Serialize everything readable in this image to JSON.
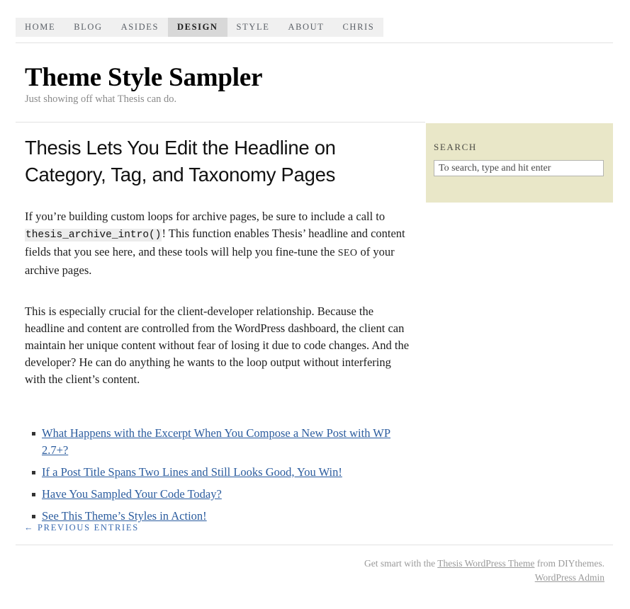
{
  "nav": {
    "items": [
      {
        "label": "Home",
        "active": false
      },
      {
        "label": "Blog",
        "active": false
      },
      {
        "label": "Asides",
        "active": false
      },
      {
        "label": "Design",
        "active": true
      },
      {
        "label": "Style",
        "active": false
      },
      {
        "label": "About",
        "active": false
      },
      {
        "label": "Chris",
        "active": false
      }
    ]
  },
  "header": {
    "title": "Theme Style Sampler",
    "tagline": "Just showing off what Thesis can do."
  },
  "main": {
    "headline": "Thesis Lets You Edit the Headline on Category, Tag, and Taxonomy Pages",
    "paragraph1": {
      "before_code": "If you’re building custom loops for archive pages, be sure to include a call to ",
      "code": "thesis_archive_intro()",
      "after_code": "! This function enables Thesis’ headline and content fields that you see here, and these tools will help you fine-tune the ",
      "smallcaps": "SEO",
      "tail": " of your archive pages."
    },
    "paragraph2": "This is especially crucial for the client-developer relationship. Because the headline and content are controlled from the WordPress dashboard, the client can maintain her unique content without fear of losing it due to code changes. And the developer? He can do anything he wants to the loop output without interfering with the client’s content.",
    "post_links": [
      "What Happens with the Excerpt When You Compose a New Post with WP 2.7+?",
      "If a Post Title Spans Two Lines and Still Looks Good, You Win!",
      "Have You Sampled Your Code Today?",
      "See This Theme’s Styles in Action!"
    ],
    "previous_entries": "← Previous Entries"
  },
  "sidebar": {
    "search": {
      "title": "Search",
      "value": "",
      "placeholder": "To search, type and hit enter"
    }
  },
  "footer": {
    "credit_prefix": "Get smart with the ",
    "credit_link": "Thesis WordPress Theme",
    "credit_suffix": " from DIYthemes.",
    "admin_link": "WordPress Admin"
  },
  "colors": {
    "nav_bg": "#f0f0f0",
    "nav_active_bg": "#d8d8d8",
    "sidebar_bg": "#e9e7c8",
    "link_blue": "#2b5c9e",
    "rule": "#e2e2e2"
  }
}
